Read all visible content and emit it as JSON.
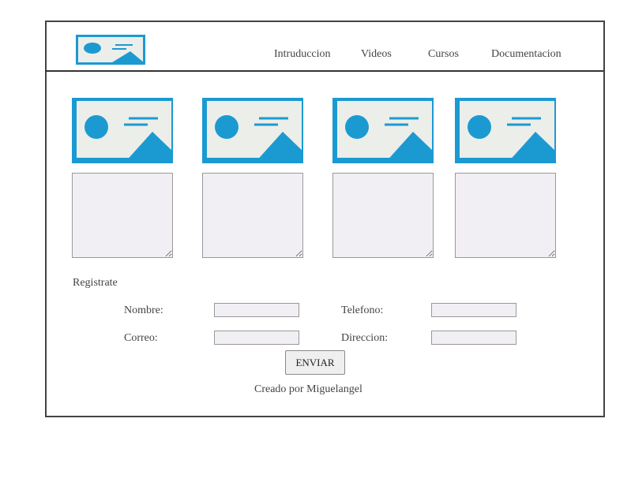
{
  "nav": {
    "items": [
      {
        "label": "Intruduccion"
      },
      {
        "label": "Videos"
      },
      {
        "label": "Cursos"
      },
      {
        "label": "Documentacion"
      }
    ]
  },
  "cards": [
    {
      "image": "image-placeholder-icon",
      "text": ""
    },
    {
      "image": "image-placeholder-icon",
      "text": ""
    },
    {
      "image": "image-placeholder-icon",
      "text": ""
    },
    {
      "image": "image-placeholder-icon",
      "text": ""
    }
  ],
  "form": {
    "title": "Registrate",
    "nombre_label": "Nombre:",
    "nombre_value": "",
    "telefono_label": "Telefono:",
    "telefono_value": "",
    "correo_label": "Correo:",
    "correo_value": "",
    "direccion_label": "Direccion:",
    "direccion_value": "",
    "submit_label": "ENVIAR"
  },
  "footer": {
    "credit": "Creado por Miguelangel"
  },
  "colors": {
    "image_blue": "#1b9ad2",
    "image_bg": "#eceeea",
    "field_bg": "#f2eff4",
    "border": "#444444"
  }
}
